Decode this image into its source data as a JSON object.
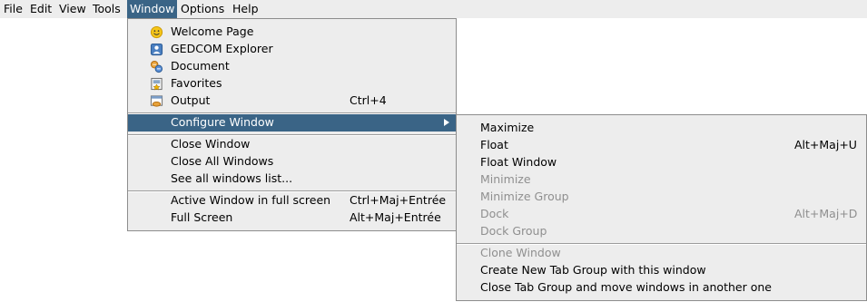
{
  "menubar": {
    "items": [
      "File",
      "Edit",
      "View",
      "Tools",
      "Window",
      "Options",
      "Help"
    ],
    "active": "Window"
  },
  "window_menu": {
    "items": [
      {
        "label": "Welcome Page",
        "shortcut": "",
        "icon": "smiley-icon"
      },
      {
        "label": "GEDCOM Explorer",
        "shortcut": "",
        "icon": "person-card-icon"
      },
      {
        "label": "Document",
        "shortcut": "",
        "icon": "document-icon"
      },
      {
        "label": "Favorites",
        "shortcut": "",
        "icon": "favorites-icon"
      },
      {
        "label": "Output",
        "shortcut": "Ctrl+4",
        "icon": "output-icon"
      },
      {
        "label": "Configure Window",
        "shortcut": "",
        "selected": true,
        "submenu": true
      },
      {
        "label": "Close Window",
        "shortcut": ""
      },
      {
        "label": "Close All Windows",
        "shortcut": ""
      },
      {
        "label": "See all windows list...",
        "shortcut": ""
      },
      {
        "label": "Active Window in full screen",
        "shortcut": "Ctrl+Maj+Entrée"
      },
      {
        "label": "Full Screen",
        "shortcut": "Alt+Maj+Entrée"
      }
    ]
  },
  "configure_submenu": {
    "items": [
      {
        "label": "Maximize",
        "shortcut": "",
        "enabled": true
      },
      {
        "label": "Float",
        "shortcut": "Alt+Maj+U",
        "enabled": true
      },
      {
        "label": "Float Window",
        "shortcut": "",
        "enabled": true
      },
      {
        "label": "Minimize",
        "shortcut": "",
        "enabled": false
      },
      {
        "label": "Minimize Group",
        "shortcut": "",
        "enabled": false
      },
      {
        "label": "Dock",
        "shortcut": "Alt+Maj+D",
        "enabled": false
      },
      {
        "label": "Dock Group",
        "shortcut": "",
        "enabled": false
      },
      {
        "label": "Clone Window",
        "shortcut": "",
        "enabled": false
      },
      {
        "label": "Create New Tab Group with this window",
        "shortcut": "",
        "enabled": true
      },
      {
        "label": "Close Tab Group and move windows in another one",
        "shortcut": "",
        "enabled": true
      }
    ]
  },
  "colors": {
    "menu_bg": "#ededed",
    "selection": "#3a6486",
    "disabled_text": "#8f8f8f"
  }
}
